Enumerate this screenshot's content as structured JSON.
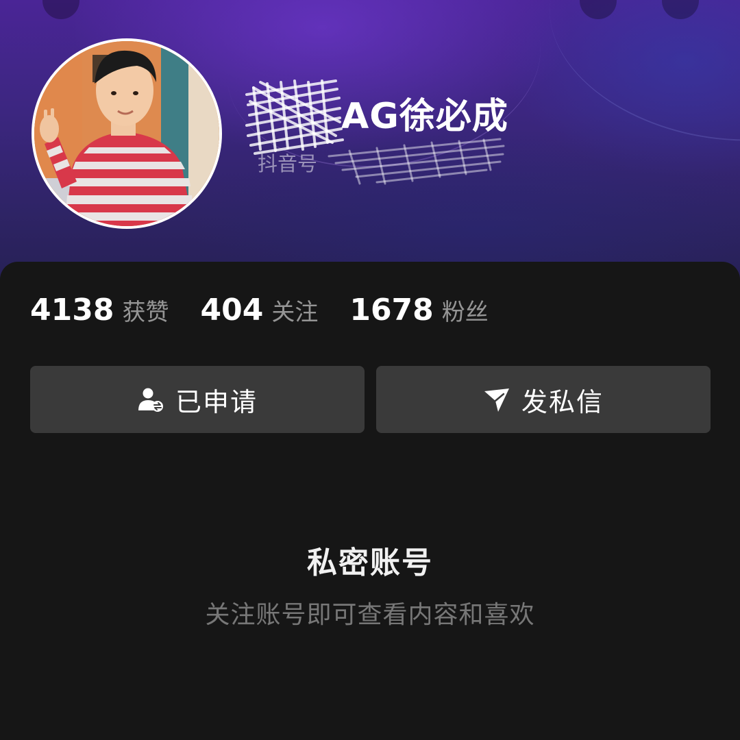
{
  "profile": {
    "nickname": "AG徐必成",
    "douyin_id_label": "抖音号"
  },
  "stats": [
    {
      "value": "4138",
      "label": "获赞"
    },
    {
      "value": "404",
      "label": "关注"
    },
    {
      "value": "1678",
      "label": "粉丝"
    }
  ],
  "actions": {
    "applied_label": "已申请",
    "message_label": "发私信"
  },
  "private_notice": {
    "title": "私密账号",
    "subtitle": "关注账号即可查看内容和喜欢"
  },
  "icons": {
    "applied": "user-pending-icon",
    "message": "paper-plane-icon"
  },
  "colors": {
    "banner_top": "#4a2596",
    "banner_bottom": "#252052",
    "background": "#161616",
    "button": "#3a3a3a"
  }
}
